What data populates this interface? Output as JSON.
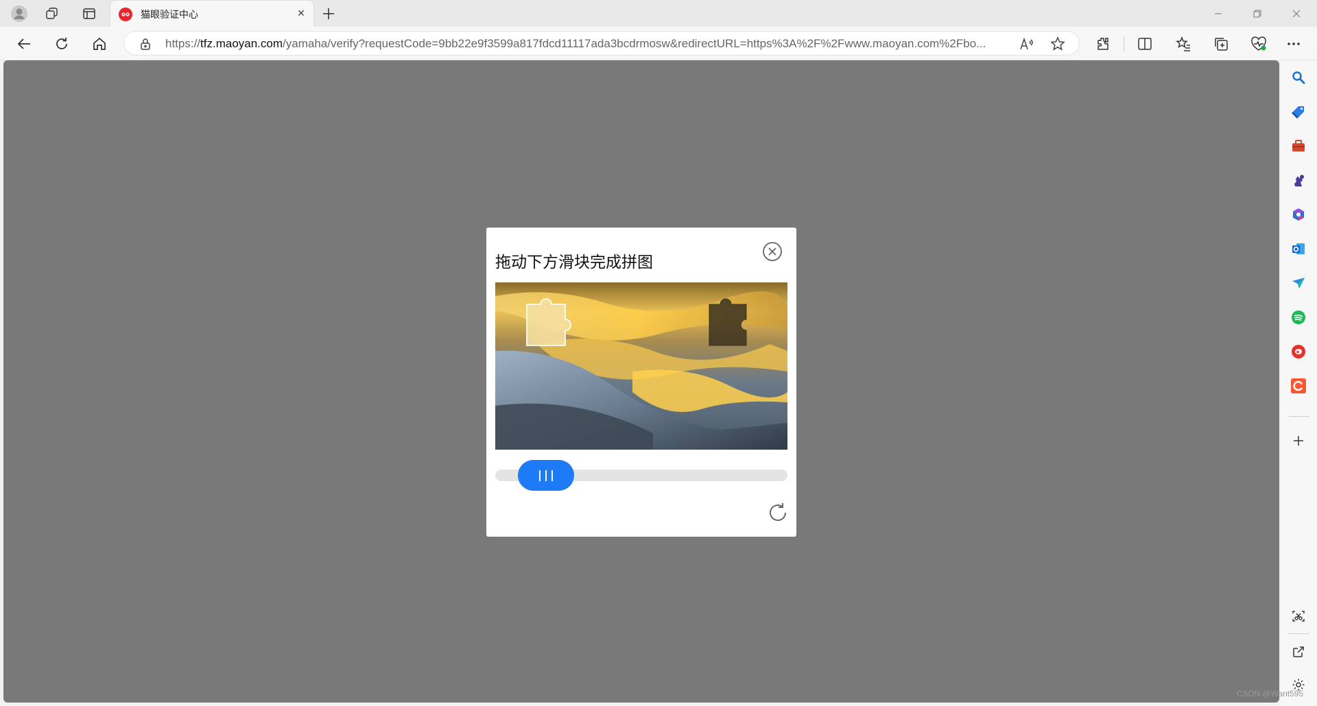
{
  "tab": {
    "title": "猫眼验证中心",
    "close": "✕"
  },
  "address": {
    "scheme": "https://",
    "host": "tfz.maoyan.com",
    "path": "/yamaha/verify?requestCode=9bb22e9f3599a817fdcd11117ada3bcdrmosw&redirectURL=https%3A%2F%2Fwww.maoyan.com%2Fbo..."
  },
  "captcha": {
    "title": "拖动下方滑块完成拼图",
    "slider_progress": 0.12,
    "puzzle_icon": "sand-dunes-image"
  },
  "sidebar": {
    "items": [
      "search-icon",
      "shopping-tag-icon",
      "toolbox-icon",
      "games-icon",
      "microsoft-365-icon",
      "outlook-icon",
      "send-icon",
      "spotify-icon",
      "weibo-icon",
      "csdn-icon"
    ]
  },
  "watermark": "CSDN @Want595",
  "colors": {
    "accent": "#1d7bf5",
    "overlay": "#797979",
    "brand": "#e8262c"
  }
}
